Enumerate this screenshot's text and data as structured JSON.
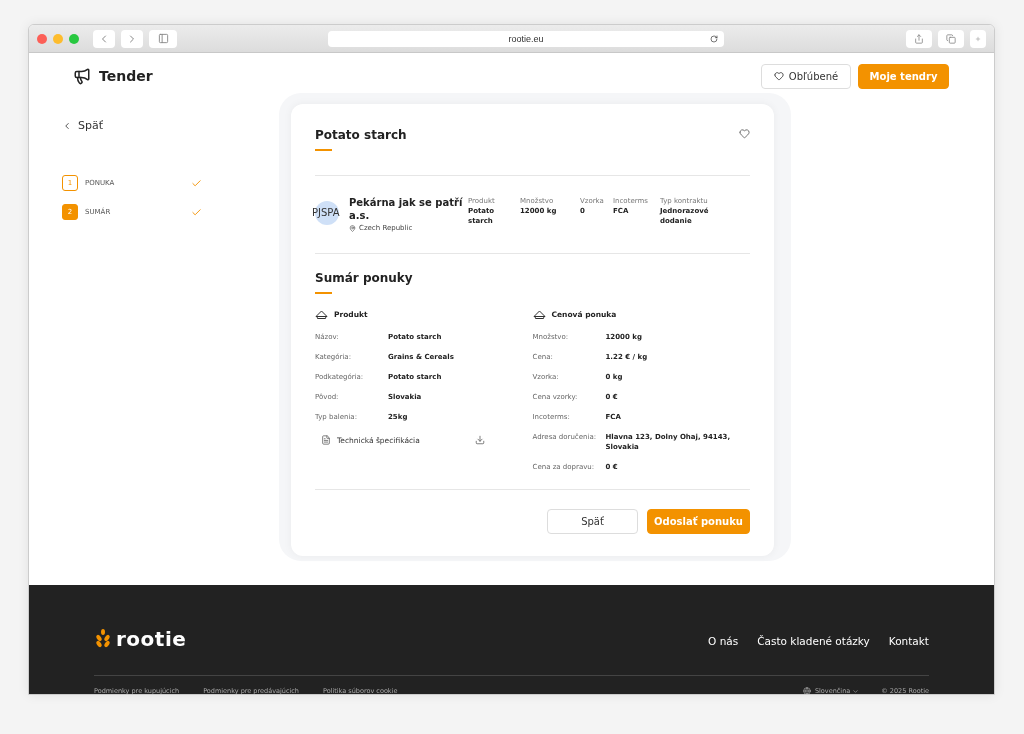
{
  "browser": {
    "url": "rootie.eu"
  },
  "header": {
    "title": "Tender",
    "buttons": [
      {
        "label": "Obľúbené",
        "kind": "outline"
      },
      {
        "label": "Moje tendry",
        "kind": "primary"
      }
    ]
  },
  "sidebar": {
    "back": "Späť",
    "steps": [
      {
        "number": "1",
        "label": "PONUKA",
        "selected": false,
        "done": true
      },
      {
        "number": "2",
        "label": "SUMÁR",
        "selected": true,
        "done": true
      }
    ]
  },
  "card": {
    "title": "Potato starch",
    "seller": {
      "avatar": "PJSPA",
      "name": "Pekárna jak se patří a.s.",
      "country": "Czech Republic"
    },
    "facts": [
      {
        "label": "Produkt",
        "value": "Potato starch"
      },
      {
        "label": "Množstvo",
        "value": "12000 kg"
      },
      {
        "label": "Vzorka",
        "value": "0"
      },
      {
        "label": "Incoterms",
        "value": "FCA"
      },
      {
        "label": "Typ kontraktu",
        "value": "Jednorazové dodanie"
      }
    ],
    "summary": {
      "title": "Sumár ponuky",
      "sections": [
        {
          "title": "Produkt",
          "rows": [
            {
              "label": "Názov:",
              "value": "Potato starch"
            },
            {
              "label": "Kategória:",
              "value": "Grains & Cereals"
            },
            {
              "label": "Podkategória:",
              "value": "Potato starch"
            },
            {
              "label": "Pôvod:",
              "value": "Slovakia"
            },
            {
              "label": "Typ balenia:",
              "value": "25kg"
            }
          ],
          "attachment": "Technická špecifikácia"
        },
        {
          "title": "Cenová ponuka",
          "rows": [
            {
              "label": "Množstvo:",
              "value": "12000 kg"
            },
            {
              "label": "Cena:",
              "value": "1.22 € / kg"
            },
            {
              "label": "Vzorka:",
              "value": "0 kg"
            },
            {
              "label": "Cena vzorky:",
              "value": "0 €"
            },
            {
              "label": "Incoterms:",
              "value": "FCA"
            },
            {
              "label": "Adresa doručenia:",
              "value": "Hlavna 123, Dolny Ohaj, 94143, Slovakia"
            },
            {
              "label": "Cena za dopravu:",
              "value": "0 €"
            }
          ]
        }
      ]
    },
    "actions": [
      {
        "label": "Späť",
        "kind": "outline"
      },
      {
        "label": "Odoslať ponuku",
        "kind": "primary"
      }
    ]
  },
  "footer": {
    "logo": "rootie",
    "links": [
      "O nás",
      "Často kladené otázky",
      "Kontakt"
    ],
    "bottom_links": [
      "Podmienky pre kupujúcich",
      "Podmienky pre predávajúcich",
      "Politika súborov cookie"
    ],
    "language": "Slovenčina",
    "copyright": "© 2025 Rootie"
  }
}
